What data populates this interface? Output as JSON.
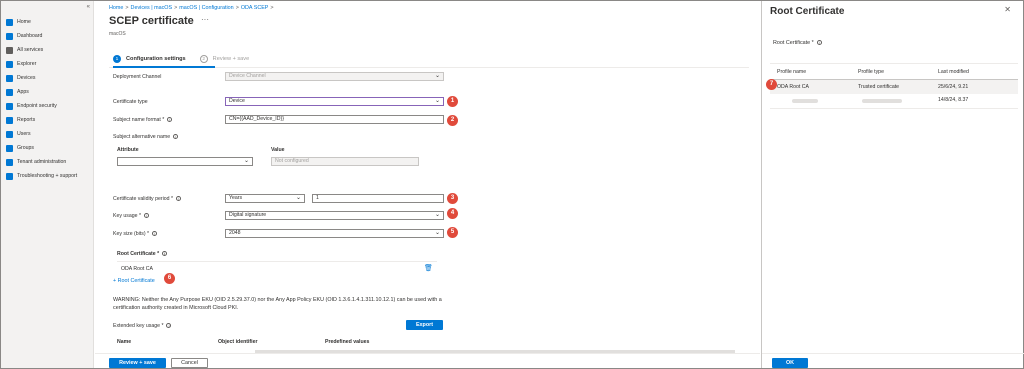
{
  "sidebar": {
    "collapse_icon": "«",
    "items": [
      {
        "label": "Home",
        "color": "#0078d4"
      },
      {
        "label": "Dashboard",
        "color": "#0078d4"
      },
      {
        "label": "All services",
        "color": "#605e5c"
      },
      {
        "label": "Explorer",
        "color": "#0078d4"
      },
      {
        "label": "Devices",
        "color": "#0078d4"
      },
      {
        "label": "Apps",
        "color": "#0078d4"
      },
      {
        "label": "Endpoint security",
        "color": "#0078d4"
      },
      {
        "label": "Reports",
        "color": "#0078d4"
      },
      {
        "label": "Users",
        "color": "#0078d4"
      },
      {
        "label": "Groups",
        "color": "#0078d4"
      },
      {
        "label": "Tenant administration",
        "color": "#0078d4"
      },
      {
        "label": "Troubleshooting + support",
        "color": "#0078d4"
      }
    ]
  },
  "breadcrumb": [
    "Home",
    "Devices | macOS",
    "macOS | Configuration",
    "ODA SCEP"
  ],
  "breadcrumb_sep": ">",
  "page": {
    "title": "SCEP certificate",
    "more": "···",
    "subtitle": "macOS"
  },
  "steps": [
    {
      "num": "1",
      "label": "Configuration settings"
    },
    {
      "num": "2",
      "label": "Review + save"
    }
  ],
  "form": {
    "deployment_channel": {
      "label": "Deployment Channel",
      "value": "Device Channel"
    },
    "certificate_type": {
      "label": "Certificate type",
      "value": "Device",
      "badge": "1"
    },
    "subject_name": {
      "label": "Subject name format *",
      "value": "CN={{AAD_Device_ID}}",
      "badge": "2"
    },
    "san": {
      "label": "Subject alternative name",
      "col_attribute": "Attribute",
      "col_value": "Value",
      "value_placeholder": "Not configured"
    },
    "validity": {
      "label": "Certificate validity period *",
      "unit": "Years",
      "value": "1",
      "badge": "3"
    },
    "key_usage": {
      "label": "Key usage *",
      "value": "Digital signature",
      "badge": "4"
    },
    "key_size": {
      "label": "Key size (bits) *",
      "value": "2048",
      "badge": "5"
    },
    "root_cert": {
      "label": "Root Certificate *",
      "item": "ODA Root CA",
      "add_link": "+ Root Certificate",
      "badge": "6"
    },
    "warning": "WARNING: Neither the Any Purpose EKU (OID 2.5.29.37.0) nor the Any App Policy EKU (OID 1.3.6.1.4.1.311.10.12.1) can be used with a certification authority created in Microsoft Cloud PKI.",
    "eku": {
      "label": "Extended key usage *",
      "export": "Export",
      "col_name": "Name",
      "col_oid": "Object identifier",
      "col_predef": "Predefined values"
    }
  },
  "footer": {
    "review": "Review + save",
    "cancel": "Cancel"
  },
  "panel": {
    "title": "Root Certificate",
    "close": "✕",
    "label": "Root Certificate *",
    "columns": [
      "Profile name",
      "Profile type",
      "Last modified"
    ],
    "rows": [
      {
        "name": "ODA Root CA",
        "type": "Trusted certificate",
        "modified": "25/6/24, 9.21",
        "badge": "7"
      },
      {
        "name": "",
        "type": "",
        "modified": "14/8/24, 8.37"
      }
    ],
    "ok": "OK"
  }
}
